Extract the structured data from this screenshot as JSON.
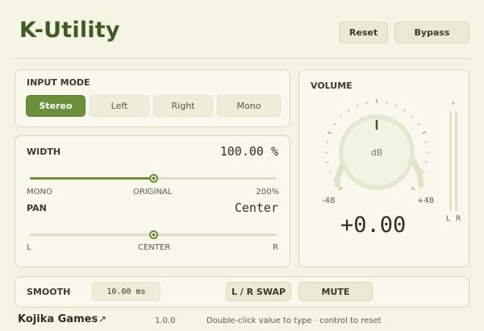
{
  "app": {
    "title": "K-Utility"
  },
  "header": {
    "reset_label": "Reset",
    "bypass_label": "Bypass"
  },
  "input_mode": {
    "label": "INPUT MODE",
    "options": [
      "Stereo",
      "Left",
      "Right",
      "Mono"
    ],
    "selected": "Stereo"
  },
  "width": {
    "label": "WIDTH",
    "value_text": "100.00 %",
    "level": 0.5,
    "min_label": "MONO",
    "mid_label": "ORIGINAL",
    "max_label": "200%"
  },
  "pan": {
    "label": "PAN",
    "value_text": "Center",
    "level": 0.5,
    "min_label": "L",
    "mid_label": "CENTER",
    "max_label": "R"
  },
  "volume": {
    "label": "VOLUME",
    "knob_unit": "dB",
    "min_label": "-48",
    "max_label": "+48",
    "value_text": "+0.00",
    "meter_left_label": "L",
    "meter_right_label": "R"
  },
  "bottom_bar": {
    "smooth_label": "SMOOTH",
    "smooth_value": "10.00 ms",
    "swap_label": "L / R SWAP",
    "mute_label": "MUTE"
  },
  "footer": {
    "brand": "Kojika Games",
    "version": "1.0.0",
    "hint": "Double-click value to type · control to reset"
  },
  "colors": {
    "accent": "#6b8f3a",
    "title": "#3f5a23",
    "background": "#f5f5e6"
  }
}
